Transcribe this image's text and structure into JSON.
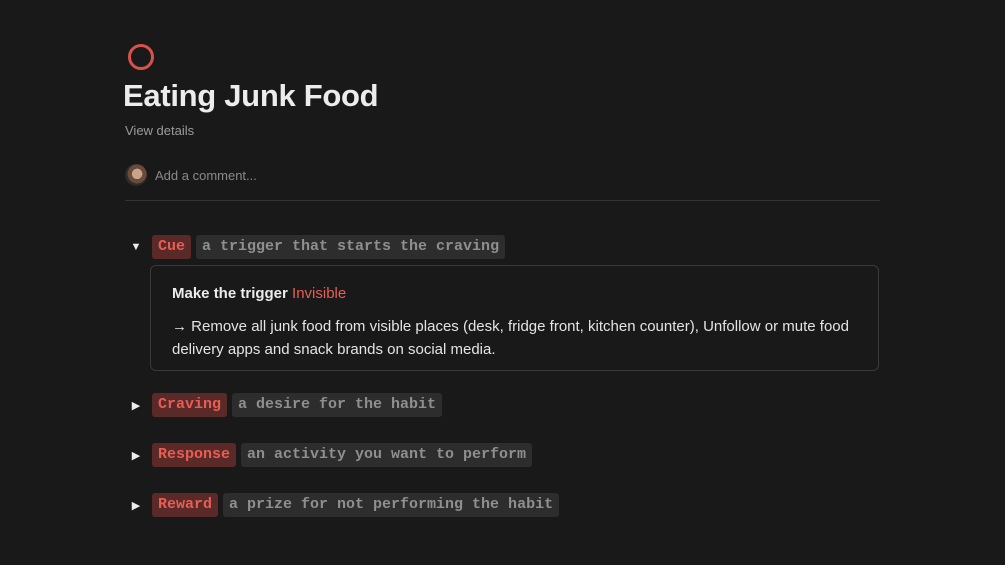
{
  "page": {
    "icon": "circle-icon",
    "title": "Eating Junk Food",
    "view_details": "View details",
    "comment_placeholder": "Add a comment..."
  },
  "colors": {
    "background": "#191919",
    "accent_red": "#e85e55",
    "tag_bg": "#5a2a28",
    "code_bg": "#2d2d2d"
  },
  "toggles": [
    {
      "label": "Cue",
      "description": "a trigger that starts the craving",
      "expanded": true,
      "callout": {
        "heading_prefix": "Make the trigger ",
        "heading_highlight": "Invisible",
        "body": "→ Remove all junk food from visible places (desk, fridge front, kitchen counter), Unfollow or mute food delivery apps and snack brands on social media."
      }
    },
    {
      "label": "Craving",
      "description": "a desire for the habit",
      "expanded": false
    },
    {
      "label": "Response",
      "description": "an activity you want to perform",
      "expanded": false
    },
    {
      "label": "Reward",
      "description": "a prize for not performing the habit",
      "expanded": false
    }
  ],
  "arrows": {
    "expanded": "▼",
    "collapsed": "▶"
  }
}
